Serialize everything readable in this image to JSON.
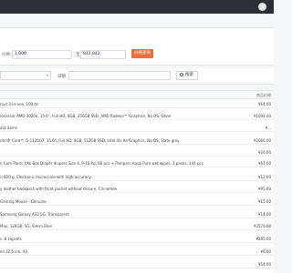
{
  "filters": {
    "min_label": "价格:",
    "min_value": "1,000",
    "max_label": "至",
    "max_value": "842,842",
    "apply_label": "价格查询",
    "select_placeholder": "",
    "date_label": "日期",
    "date_placeholder": "",
    "search_label": "搜索"
  },
  "table": {
    "price_header": "商品价格",
    "rows": [
      {
        "name": "rout 3-in-one, 100 ml",
        "price": "¥64.00"
      },
      {
        "name": "rocessor AMD 3020e, 15.6\", Full HD, 8GB, 256GB SSD, AMD Radeon™ Graphics, No OS, Silver",
        "price": "¥1092.00"
      },
      {
        "name": "out items",
        "price": "¥..."
      },
      {
        "name": "ntel® Core™ i5-1135G7, 15.6\", Full HD, 8GB, 512GB SSD, Intel Iris Xe Graphics, No OS, Slate grey",
        "price": "¥2066.00"
      },
      {
        "name": "",
        "price": "¥26.00"
      },
      {
        "name": "n Care Pants XXL Box Diaper diapers Size 4, 9-15 kg, 88 pcs + Pampers Aqua Pure wet wipes, 3 packs, 144 pcs",
        "price": "¥61.00"
      },
      {
        "name": "): 620 g, Electronic microscale with high accuracy",
        "price": "¥12.00"
      },
      {
        "name": "y leather backpack with front pocket without closure, Cinnamon",
        "price": "¥95.00"
      },
      {
        "name": "Gaming Mouse - Genuine",
        "price": "¥15.00"
      },
      {
        "name": "Samsung Galaxy A32 5G, Transparent",
        "price": "¥14.00"
      },
      {
        "name": "Max, 128GB, 5G, Sierra Blue",
        "price": "¥2570.00"
      },
      {
        "name": "s, 8 capsets",
        "price": "¥285.00"
      },
      {
        "name": "ell 12,5 cm, A4",
        "price": "¥8.00"
      },
      {
        "name": "",
        "price": "¥54.00"
      }
    ]
  }
}
